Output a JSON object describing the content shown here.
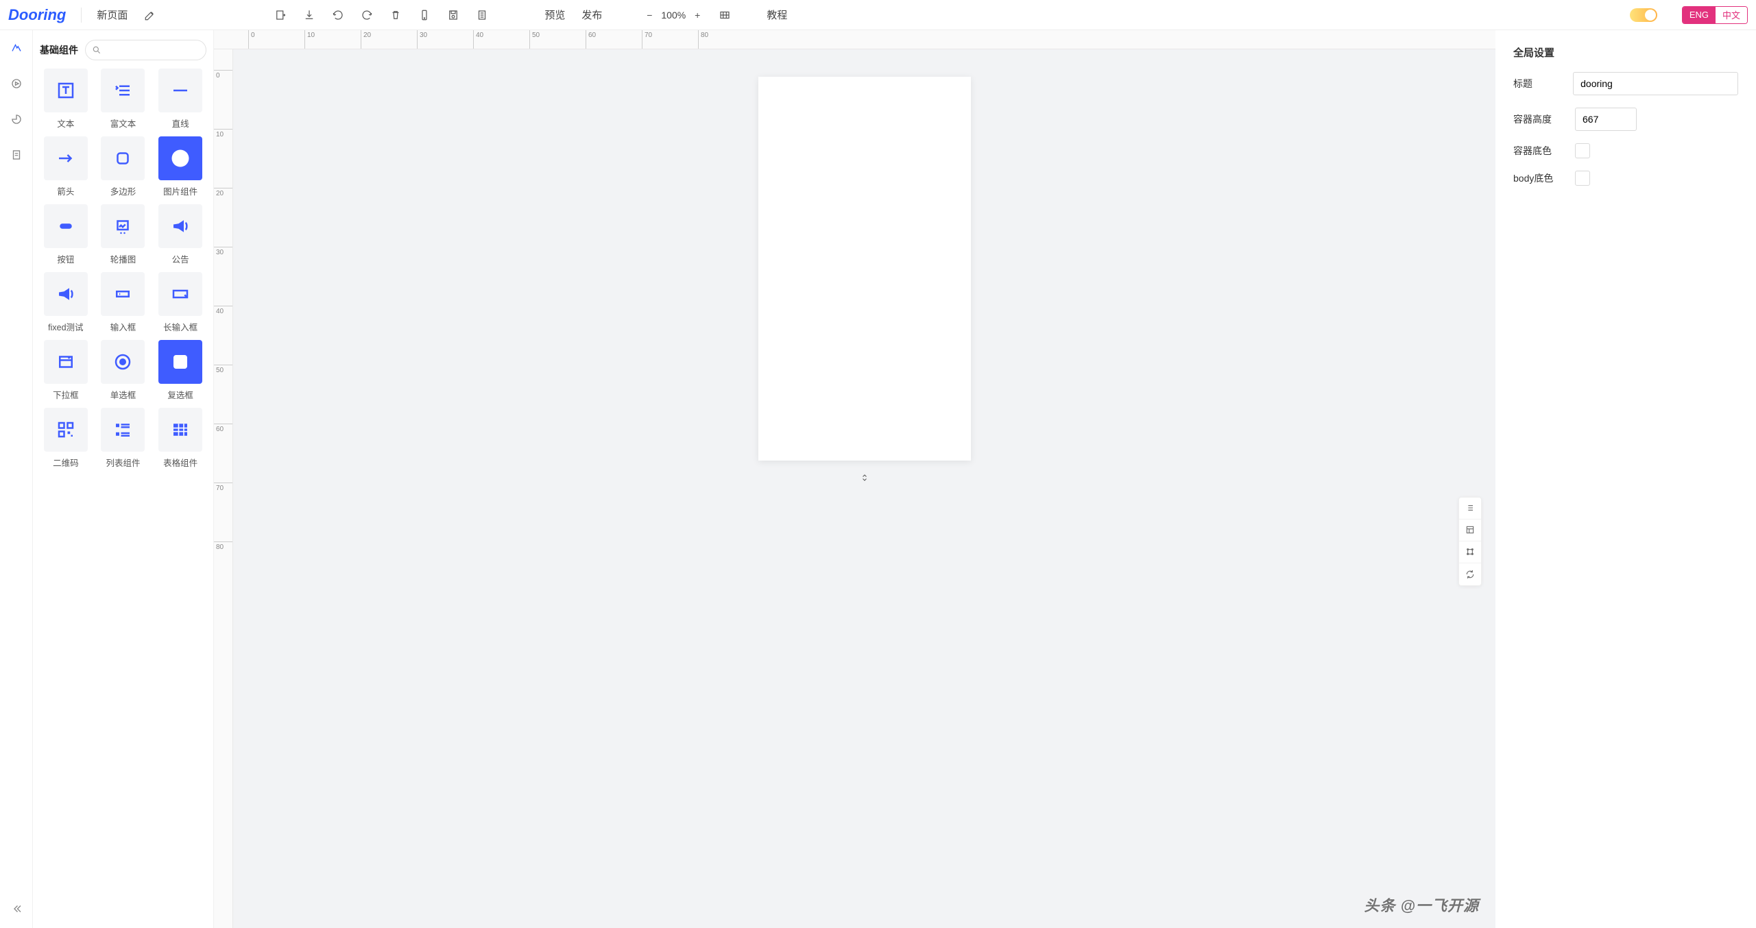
{
  "app_name": "Dooring",
  "header": {
    "new_page": "新页面",
    "preview": "预览",
    "publish": "发布",
    "zoom": "100%",
    "tutorial": "教程",
    "lang_eng": "ENG",
    "lang_zh": "中文"
  },
  "panel": {
    "title": "基础组件",
    "search_placeholder": "",
    "components": [
      {
        "id": "text",
        "label": "文本"
      },
      {
        "id": "richtext",
        "label": "富文本"
      },
      {
        "id": "line",
        "label": "直线"
      },
      {
        "id": "arrow",
        "label": "箭头"
      },
      {
        "id": "polygon",
        "label": "多边形"
      },
      {
        "id": "image",
        "label": "图片组件"
      },
      {
        "id": "button",
        "label": "按钮"
      },
      {
        "id": "carousel",
        "label": "轮播图"
      },
      {
        "id": "notice",
        "label": "公告"
      },
      {
        "id": "fixed",
        "label": "fixed测试"
      },
      {
        "id": "input",
        "label": "输入框"
      },
      {
        "id": "longinput",
        "label": "长输入框"
      },
      {
        "id": "select",
        "label": "下拉框"
      },
      {
        "id": "radio",
        "label": "单选框"
      },
      {
        "id": "checkbox",
        "label": "复选框"
      },
      {
        "id": "qrcode",
        "label": "二维码"
      },
      {
        "id": "list",
        "label": "列表组件"
      },
      {
        "id": "table",
        "label": "表格组件"
      }
    ]
  },
  "ruler": {
    "h": [
      "0",
      "10",
      "20",
      "30",
      "40",
      "50",
      "60",
      "70",
      "80"
    ],
    "v": [
      "0",
      "10",
      "20",
      "30",
      "40",
      "50",
      "60",
      "70",
      "80"
    ]
  },
  "props": {
    "section_title": "全局设置",
    "title_label": "标题",
    "title_value": "dooring",
    "height_label": "容器高度",
    "height_value": "667",
    "bg_label": "容器底色",
    "body_bg_label": "body底色"
  },
  "watermark": "头条 @一飞开源"
}
